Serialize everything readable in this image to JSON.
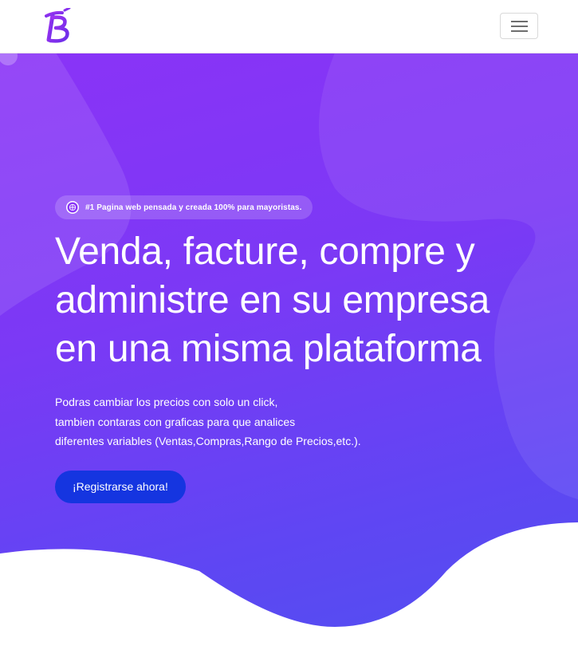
{
  "navbar": {
    "logo_letter": "B",
    "toggle_icon": "hamburger-menu-icon"
  },
  "hero": {
    "badge": {
      "icon": "globe-icon",
      "text": "#1 Pagina web pensada y creada 100% para mayoristas."
    },
    "headline_lines": [
      "Venda, facture, compre y",
      "administre en su empresa",
      "en una misma plataforma"
    ],
    "description_lines": [
      "Podras cambiar los precios con solo un click,",
      "tambien contaras con graficas para que analices",
      "diferentes variables (Ventas,Compras,Rango de Precios,etc.)."
    ],
    "cta_label": "¡Registrarse ahora!"
  },
  "colors": {
    "brand_purple": "#8a33f7",
    "cta_blue": "#1535e0",
    "gradient_end": "#5050f0"
  }
}
